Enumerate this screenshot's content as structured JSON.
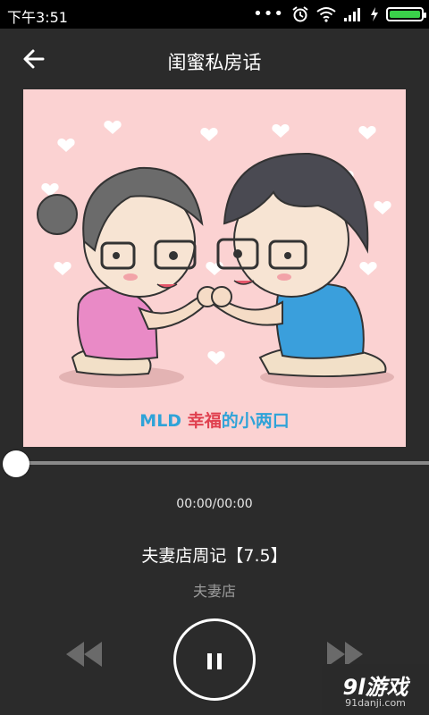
{
  "status": {
    "time": "下午3:51",
    "dots": "•••"
  },
  "header": {
    "title": "闺蜜私房话"
  },
  "artwork": {
    "caption_prefix": "MLD ",
    "caption_highlight": "幸福",
    "caption_suffix": "的小两口"
  },
  "player": {
    "progress": 0,
    "time_readout": "00:00/00:00",
    "song_title": "夫妻店周记【7.5】",
    "artist": "夫妻店"
  },
  "watermark": {
    "main": "9l游戏",
    "sub": "91danji.com"
  },
  "colors": {
    "accent_green": "#3ad14a",
    "art_background": "#fbd2d2",
    "caption_blue": "#2fa3d8",
    "caption_red": "#e0404f"
  }
}
